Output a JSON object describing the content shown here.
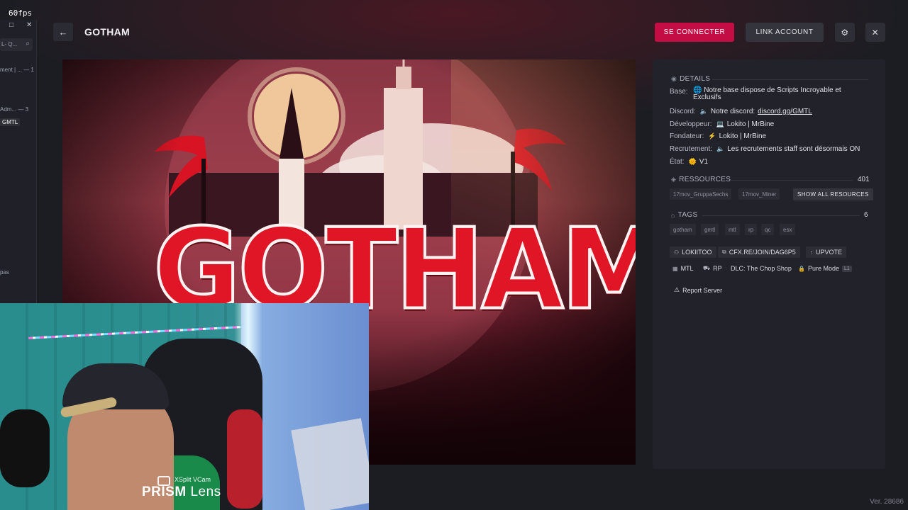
{
  "overlay": {
    "fps": "60fps"
  },
  "sidebar": {
    "search_text": "L- Q...",
    "rows": [
      {
        "text": "ment | ... — 1"
      },
      {
        "text": "Adm... — 3"
      },
      {
        "tag": "GMTL"
      },
      {
        "text": "pas"
      }
    ]
  },
  "header": {
    "title": "GOTHAM",
    "back_icon": "arrow-left-icon",
    "connect_label": "SE CONNECTER",
    "link_label": "LINK ACCOUNT",
    "settings_icon": "gear-icon",
    "close_icon": "close-icon",
    "accent": "#c40c45"
  },
  "banner": {
    "word": "GOTHAM"
  },
  "webcam": {
    "brand_small": "XSplit VCam",
    "brand_big": "PRISM",
    "brand_big2": "Lens"
  },
  "details": {
    "heading": "DETAILS",
    "base_label": "Base:",
    "base_value": "Notre base dispose de Scripts Incroyable et Exclusifs",
    "discord_label": "Discord:",
    "discord_prefix": "Notre discord:",
    "discord_link": "discord.gg/GMTL",
    "dev_label": "Développeur:",
    "dev_value": "Lokito | MrBine",
    "founder_label": "Fondateur:",
    "founder_value": "Lokito | MrBine",
    "recruit_label": "Recrutement:",
    "recruit_value": "Les recrutements staff sont désormais ON",
    "state_label": "État:",
    "state_value": "V1"
  },
  "resources": {
    "heading": "RESSOURCES",
    "count": "401",
    "items": [
      "17mov_GruppaSechs",
      "17mov_Miner"
    ],
    "show_all": "SHOW ALL RESOURCES"
  },
  "tags": {
    "heading": "TAGS",
    "count": "6",
    "items": [
      "gotham",
      "gmtl",
      "mtl",
      "rp",
      "qc",
      "esx"
    ]
  },
  "links": {
    "owner": "LOKIITOO",
    "join": "CFX.RE/JOIN/DAG6P5",
    "upvote": "UPVOTE",
    "mtl": "MTL",
    "rp": "RP",
    "dlc": "DLC: The Chop Shop",
    "pure_mode": "Pure Mode",
    "pure_badge": "L1",
    "report": "Report Server"
  },
  "footer": {
    "version": "Ver. 28686"
  }
}
